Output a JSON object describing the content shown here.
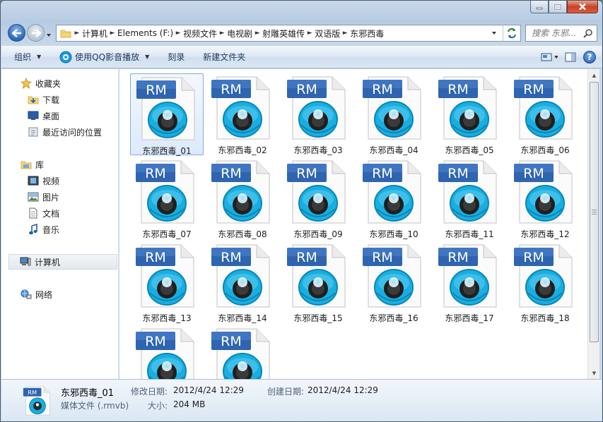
{
  "window": {
    "caption_buttons": [
      "minimize",
      "maximize",
      "close"
    ]
  },
  "address_bar": {
    "breadcrumbs": [
      "计算机",
      "Elements (F:)",
      "视频文件",
      "电视剧",
      "射雕英雄传",
      "双语版",
      "东邪西毒"
    ]
  },
  "search": {
    "placeholder": "搜索 东邪..."
  },
  "toolbar": {
    "organize": "组织",
    "play_with_qq": "使用QQ影音播放",
    "burn": "刻录",
    "new_folder": "新建文件夹"
  },
  "nav_pane": {
    "favorites": "收藏夹",
    "downloads": "下载",
    "desktop": "桌面",
    "recent": "最近访问的位置",
    "libraries": "库",
    "videos": "视频",
    "pictures": "图片",
    "documents": "文档",
    "music": "音乐",
    "computer": "计算机",
    "network": "网络"
  },
  "files": [
    {
      "name": "东邪西毒_01",
      "badge": "RM"
    },
    {
      "name": "东邪西毒_02",
      "badge": "RM"
    },
    {
      "name": "东邪西毒_03",
      "badge": "RM"
    },
    {
      "name": "东邪西毒_04",
      "badge": "RM"
    },
    {
      "name": "东邪西毒_05",
      "badge": "RM"
    },
    {
      "name": "东邪西毒_06",
      "badge": "RM"
    },
    {
      "name": "东邪西毒_07",
      "badge": "RM"
    },
    {
      "name": "东邪西毒_08",
      "badge": "RM"
    },
    {
      "name": "东邪西毒_09",
      "badge": "RM"
    },
    {
      "name": "东邪西毒_10",
      "badge": "RM"
    },
    {
      "name": "东邪西毒_11",
      "badge": "RM"
    },
    {
      "name": "东邪西毒_12",
      "badge": "RM"
    },
    {
      "name": "东邪西毒_13",
      "badge": "RM"
    },
    {
      "name": "东邪西毒_14",
      "badge": "RM"
    },
    {
      "name": "东邪西毒_15",
      "badge": "RM"
    },
    {
      "name": "东邪西毒_16",
      "badge": "RM"
    },
    {
      "name": "东邪西毒_17",
      "badge": "RM"
    },
    {
      "name": "东邪西毒_18",
      "badge": "RM"
    },
    {
      "name": "",
      "badge": "RM"
    },
    {
      "name": "",
      "badge": "RM"
    }
  ],
  "selected_file": 0,
  "details": {
    "name": "东邪西毒_01",
    "type": "媒体文件 (.rmvb)",
    "modified_label": "修改日期:",
    "modified_value": "2012/4/24 12:29",
    "created_label": "创建日期:",
    "created_value": "2012/4/24 12:29",
    "size_label": "大小:",
    "size_value": "204 MB",
    "badge": "RM"
  },
  "colors": {
    "badge_blue": "#2f64b0",
    "icon_cyan": "#18aee0",
    "selection_border": "#84acdd"
  },
  "icons": [
    "back-arrow-icon",
    "forward-arrow-icon",
    "folder-icon",
    "refresh-icon",
    "search-icon",
    "qq-player-icon",
    "view-options-icon",
    "preview-pane-icon",
    "help-icon",
    "star-icon",
    "rm-media-file-icon"
  ]
}
